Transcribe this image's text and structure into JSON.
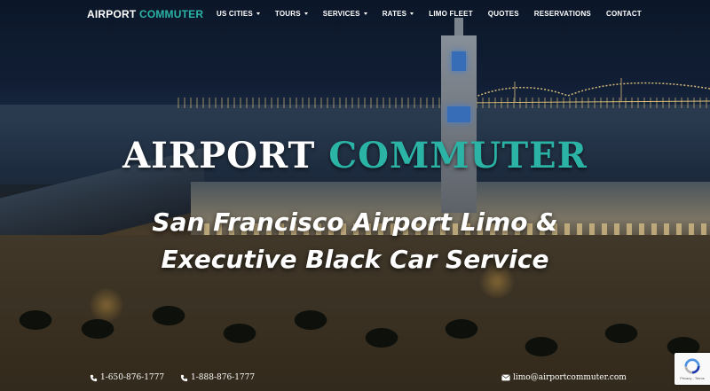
{
  "brand": {
    "part1": "AIRPORT",
    "part2": "COMMUTER",
    "accent_color": "#2bb3a6"
  },
  "nav": {
    "items": [
      {
        "label": "US CITIES",
        "dropdown": true
      },
      {
        "label": "TOURS",
        "dropdown": true
      },
      {
        "label": "SERVICES",
        "dropdown": true
      },
      {
        "label": "RATES",
        "dropdown": true
      },
      {
        "label": "LIMO FLEET",
        "dropdown": false
      },
      {
        "label": "QUOTES",
        "dropdown": false
      },
      {
        "label": "RESERVATIONS",
        "dropdown": false
      },
      {
        "label": "CONTACT",
        "dropdown": false
      }
    ]
  },
  "hero": {
    "title_part1": "AIRPORT",
    "title_part2": "COMMUTER",
    "subtitle_line1": "San Francisco Airport Limo &",
    "subtitle_line2": "Executive Black Car Service"
  },
  "contacts": {
    "phone1": "1-650-876-1777",
    "phone2": "1-888-876-1777",
    "email": "limo@airportcommuter.com"
  },
  "recaptcha": {
    "text": "Privacy - Terms"
  },
  "icons": {
    "phone": "phone-icon",
    "email": "envelope-icon",
    "recaptcha": "recaptcha-icon"
  }
}
